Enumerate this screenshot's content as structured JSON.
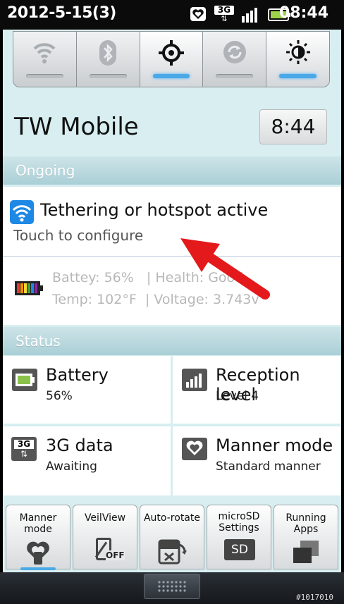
{
  "status_bar": {
    "date": "2012-5-15(3)",
    "network": "3G",
    "time": "08:44"
  },
  "quick_settings": [
    {
      "name": "wifi",
      "active": false
    },
    {
      "name": "bluetooth",
      "active": false
    },
    {
      "name": "gps",
      "active": true
    },
    {
      "name": "sync",
      "active": false
    },
    {
      "name": "brightness",
      "active": true
    }
  ],
  "carrier": "TW Mobile",
  "clock": "8:44",
  "ongoing": {
    "header": "Ongoing",
    "tether_title": "Tethering or hotspot active",
    "tether_sub": "Touch to configure",
    "battery_line1": "Battey: 56%   | Health: Good",
    "battery_line2": "Temp: 102°F  | Voltage: 3.743v"
  },
  "status": {
    "header": "Status",
    "battery_title": "Battery",
    "battery_value": "56%",
    "reception_title": "Reception level",
    "reception_value": "Level 4",
    "data_title": "3G data",
    "data_value": "Awaiting",
    "manner_title": "Manner mode",
    "manner_value": "Standard manner"
  },
  "apps": {
    "manner": "Manner mode",
    "veilview": "VeilView",
    "autorotate": "Auto-rotate",
    "microsd_1": "microSD",
    "microsd_2": "Settings",
    "running": "Running Apps",
    "sd_badge": "SD",
    "off_badge": "OFF"
  },
  "watermark": "#1017010",
  "colors": {
    "accent_blue": "#4aa9e6",
    "panel_bg": "#d8eef0",
    "arrow_red": "#e3191b"
  }
}
